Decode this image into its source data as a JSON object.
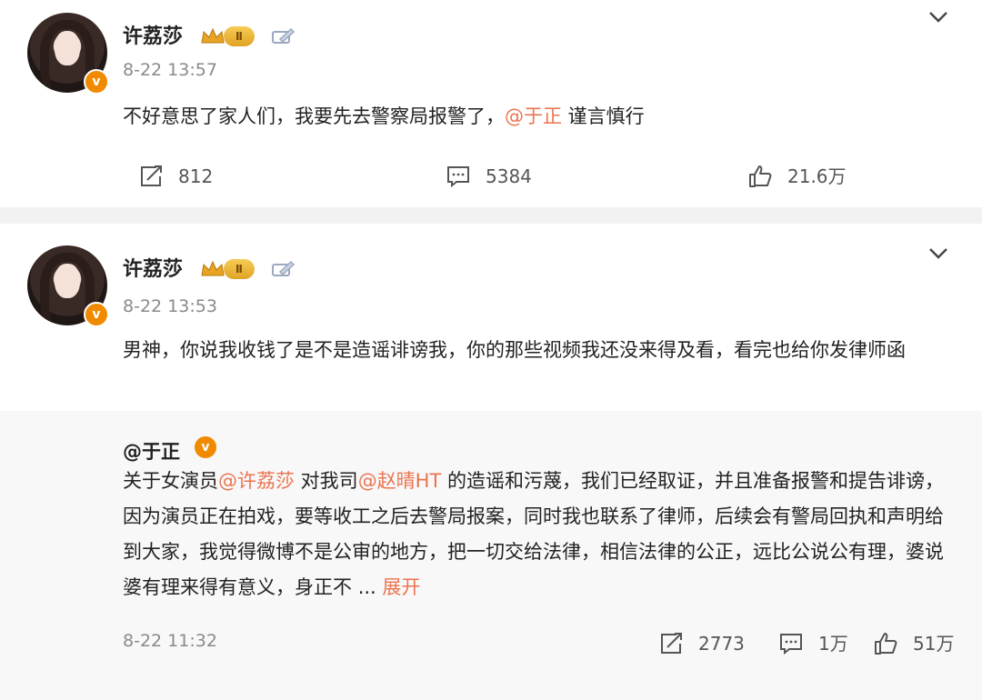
{
  "accent_color": "#eb7350",
  "post1": {
    "author": "许荔莎",
    "level": "Ⅱ",
    "time": "8-22 13:57",
    "text_before": "不好意思了家人们，我要先去警察局报警了，",
    "mention": "@于正",
    "text_after": " 谨言慎行",
    "reposts": "812",
    "comments": "5384",
    "likes": "21.6万"
  },
  "post2": {
    "author": "许荔莎",
    "level": "Ⅱ",
    "time": "8-22 13:53",
    "text": "男神，你说我收钱了是不是造谣诽谤我，你的那些视频我还没来得及看，看完也给你发律师函",
    "original": {
      "author": "@于正",
      "verified_mark": "v",
      "seg1": "关于女演员",
      "mention1": "@许荔莎",
      "seg2": " 对我司",
      "mention2": "@赵晴HT",
      "seg3": " 的造谣和污蔑，我们已经取证，并且准备报警和提告诽谤，因为演员正在拍戏，要等收工之后去警局报案，同时我也联系了律师，后续会有警局回执和声明给到大家，我觉得微博不是公审的地方，把一切交给法律，相信法律的公正，远比公说公有理，婆说婆有理来得有意义，身正不 ",
      "ellipsis": "...",
      "expand": "展开",
      "time": "8-22 11:32",
      "reposts": "2773",
      "comments": "1万",
      "likes": "51万"
    }
  }
}
